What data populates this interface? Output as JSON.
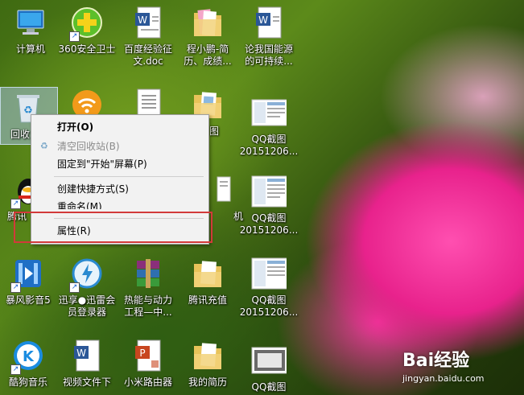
{
  "desktop": {
    "icons": [
      {
        "label": "计算机",
        "lines": [
          "计算机"
        ]
      },
      {
        "label": "360安全卫士",
        "lines": [
          "360安全卫士"
        ]
      },
      {
        "label": "百度经验征文.doc",
        "lines": [
          "百度经验征",
          "文.doc"
        ]
      },
      {
        "label": "程小鹏-简历、成绩...",
        "lines": [
          "程小鹏-简",
          "历、成绩..."
        ]
      },
      {
        "label": "论我国能源的可持续...",
        "lines": [
          "论我国能源",
          "的可持续..."
        ]
      },
      {
        "label": "回收站",
        "lines": [
          "回收"
        ]
      },
      {
        "label": "QQ截图20151206...",
        "lines": [
          "QQ截图",
          "20151206..."
        ]
      },
      {
        "label": "腾讯QQ",
        "lines": [
          "腾讯"
        ]
      },
      {
        "label": "QQ截图20151206...",
        "lines": [
          "QQ截图",
          "20151206..."
        ]
      },
      {
        "label": "暴风影音5",
        "lines": [
          "暴风影音5"
        ]
      },
      {
        "label": "迅享●迅雷会员登录器",
        "lines": [
          "迅享●迅雷会",
          "员登录器"
        ]
      },
      {
        "label": "热能与动力工程—中...",
        "lines": [
          "热能与动力",
          "工程—中..."
        ]
      },
      {
        "label": "腾讯充值",
        "lines": [
          "腾讯充值"
        ]
      },
      {
        "label": "QQ截图20151206...",
        "lines": [
          "QQ截图",
          "20151206..."
        ]
      },
      {
        "label": "酷狗音乐",
        "lines": [
          "酷狗音乐"
        ]
      },
      {
        "label": "视频文件下",
        "lines": [
          "视频文件下"
        ]
      },
      {
        "label": "小米路由器",
        "lines": [
          "小米路由器"
        ]
      },
      {
        "label": "我的简历",
        "lines": [
          "我的简历"
        ]
      },
      {
        "label": "QQ截图",
        "lines": [
          "QQ截图"
        ]
      }
    ],
    "partial_labels": {
      "image_folder": "图",
      "qq_right": "机"
    }
  },
  "context_menu": {
    "items": [
      {
        "label": "打开(O)"
      },
      {
        "label": "清空回收站(B)"
      },
      {
        "label": "固定到\"开始\"屏幕(P)"
      },
      {
        "label": "创建快捷方式(S)"
      },
      {
        "label": "重命名(M)"
      },
      {
        "label": "属性(R)"
      }
    ]
  },
  "watermark": {
    "logo": "Bai经验",
    "url": "jingyan.baidu.com"
  },
  "colors": {
    "highlight_box": "#d23a3a",
    "menu_bg": "#f2f2f2",
    "selection": "#a0bedc"
  }
}
